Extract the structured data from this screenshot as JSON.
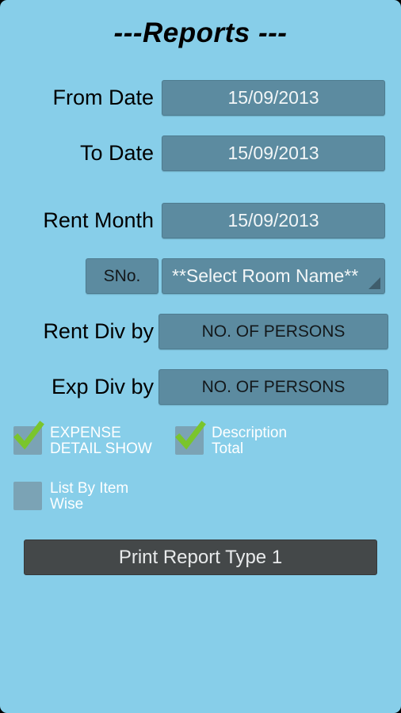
{
  "screen": {
    "title": "---Reports ---",
    "background_color": "#87cee9",
    "field_color": "#5c8ba0",
    "checkbox_color": "#7ba3b5",
    "check_color": "#7ac52c",
    "button_color": "#444849"
  },
  "form": {
    "from_date": {
      "label": "From Date",
      "value": "15/09/2013"
    },
    "to_date": {
      "label": "To Date",
      "value": "15/09/2013"
    },
    "rent_month": {
      "label": "Rent Month",
      "value": "15/09/2013"
    },
    "serial_number": {
      "label": "SNo."
    },
    "room_name": {
      "value": "**Select Room Name**",
      "arrow_icon": "spinner-arrow-icon"
    },
    "rent_div_by": {
      "label": "Rent Div by",
      "value": "NO. OF PERSONS"
    },
    "exp_div_by": {
      "label": "Exp Div by",
      "value": "NO. OF PERSONS"
    }
  },
  "checkboxes": [
    {
      "label": "EXPENSE\nDETAIL SHOW",
      "checked": true
    },
    {
      "label": "Description\nTotal",
      "checked": true
    },
    {
      "label": "List By Item\nWise",
      "checked": false
    }
  ],
  "actions": {
    "print_report": "Print Report Type 1"
  }
}
